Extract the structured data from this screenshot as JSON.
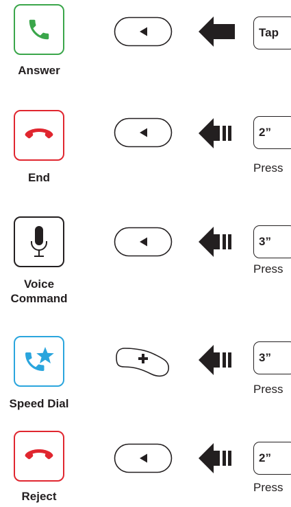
{
  "colors": {
    "answer_green": "#3aa64a",
    "end_red": "#e0262f",
    "speed_dial_blue": "#2aa5dd",
    "ink": "#231f20"
  },
  "rows": [
    {
      "caption": "Answer",
      "icon": "phone-icon",
      "icon_color": "#3aa64a",
      "button": "back-button",
      "arrow": "solid-left-arrow-icon",
      "duration": "Tap",
      "press": ""
    },
    {
      "caption": "End",
      "icon": "hang-up-icon",
      "icon_color": "#e0262f",
      "button": "back-button",
      "arrow": "hold-left-arrow-icon",
      "duration": "2”",
      "press": "Press"
    },
    {
      "caption": "Voice Command",
      "caption_lines": [
        "Voice",
        "Command"
      ],
      "icon": "microphone-icon",
      "icon_color": "#231f20",
      "button": "back-button",
      "arrow": "hold-left-arrow-icon",
      "duration": "3”",
      "press": "Press"
    },
    {
      "caption": "Speed Dial",
      "icon": "phone-star-icon",
      "icon_color": "#2aa5dd",
      "button": "plus-button",
      "arrow": "hold-left-arrow-icon",
      "duration": "3”",
      "press": "Press"
    },
    {
      "caption": "Reject",
      "icon": "hang-up-icon",
      "icon_color": "#e0262f",
      "button": "back-button",
      "arrow": "hold-left-arrow-icon",
      "duration": "2”",
      "press": "Press"
    }
  ]
}
